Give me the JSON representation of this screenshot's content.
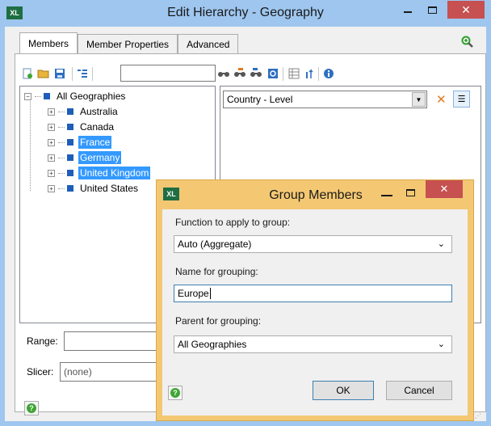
{
  "window": {
    "app_icon": "XL",
    "title": "Edit Hierarchy - Geography"
  },
  "tabs": [
    {
      "label": "Members",
      "active": true
    },
    {
      "label": "Member Properties",
      "active": false
    },
    {
      "label": "Advanced",
      "active": false
    }
  ],
  "toolbar": {
    "icons": [
      "new-icon",
      "open-folder-icon",
      "save-icon",
      "tree-view-icon",
      "find-icon",
      "find-next-icon",
      "find-previous-icon",
      "search-icon",
      "grid-icon",
      "sort-icon",
      "info-icon"
    ],
    "search_value": ""
  },
  "tree": {
    "root": "All Geographies",
    "children": [
      {
        "label": "Australia",
        "selected": false
      },
      {
        "label": "Canada",
        "selected": false
      },
      {
        "label": "France",
        "selected": true
      },
      {
        "label": "Germany",
        "selected": true
      },
      {
        "label": "United Kingdom",
        "selected": true
      },
      {
        "label": "United States",
        "selected": false
      }
    ]
  },
  "level": {
    "selected": "Country - Level"
  },
  "range": {
    "label": "Range:",
    "value": ""
  },
  "slicer": {
    "label": "Slicer:",
    "value": "(none)"
  },
  "dialog": {
    "app_icon": "XL",
    "title": "Group Members",
    "function_label": "Function to apply to group:",
    "function_value": "Auto (Aggregate)",
    "name_label": "Name for grouping:",
    "name_value": "Europe",
    "parent_label": "Parent for grouping:",
    "parent_value": "All Geographies",
    "ok_label": "OK",
    "cancel_label": "Cancel"
  },
  "colors": {
    "selection": "#3399ff",
    "dialog_frame": "#f4c873",
    "window_frame": "#9ec6ef",
    "close_button": "#c75050"
  }
}
